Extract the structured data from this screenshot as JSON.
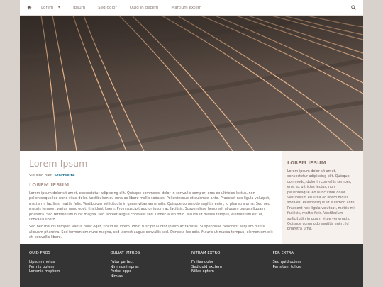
{
  "nav": {
    "items": [
      {
        "label": "Lorem",
        "has_dropdown": true
      },
      {
        "label": "Ipsum"
      },
      {
        "label": "Sed dolor"
      },
      {
        "label": "Quid in decem"
      },
      {
        "label": "Martium extem"
      }
    ]
  },
  "main": {
    "title": "Lorem Ipsum",
    "breadcrumb_prefix": "Sie sind hier:",
    "breadcrumb_link": "Startseite",
    "section_title": "LOREM IPSUM",
    "paragraphs": [
      "Lorem ipsum dolor sit amet, consectetur adipiscing elit. Quisque commodo, dolor in convallis semper, eros ex ultricies lectus, non pellentesque leo nunc vitae dolor. Vestibulum eu urna ac libero mollis sodales. Pellentesque ut euismod ante. Praesent nec ligula volutpat, mattis mi facilisis, mattis felis. Vestibulum sollicitudin in quam vitae venenatis. Quisque commodo sagittis enim, id pharetra urna. Sed nec mauris tempor, varius nunc eget, tincidunt lorem. Proin suscipit auctor ipsum ac facilisis. Suspendisse hendrerit aliquam purus aliquam pharetra. Sed fermentum nunc magna, sed laoreet augue convallis sed. Donec a leo odio. Mauris ut massa tempus, elementum elit et, convallis libero.",
      "Sed nec mauris tempor, varius nunc eget, tincidunt lorem. Proin suscipit auctor ipsum ac facilisis. Suspendisse hendrerit aliquam purus aliquam pharetra. Sed fermentum nunc magna, sed laoreet augue convallis sed. Donec a leo odio. Mauris ut massa tempus, elementum elit et, convallis libero."
    ]
  },
  "aside": {
    "title": "LOREM IPSUM",
    "text": "Lorem ipsum dolor sit amet, consectetur adipiscing elit. Quisque commodo, dolor in convallis semper, eros ex ultricies lectus, non pellentesque leo nunc vitae dolor. Vestibulum eu urna ac libero mollis sodales. Pellentesque ut euismod ante. Praesent nec ligula volutpat, mattis mi facilisis, mattis felis. Vestibulum sollicitudin in quam vitae venenatis. Quisque commodo sagittis enim, id pharetra urna."
  },
  "footer": {
    "columns": [
      {
        "heading": "QUID PROS",
        "links": [
          "Lipsum rhetus",
          "Permix optem",
          "Loremix moptem"
        ]
      },
      {
        "heading": "QULIAT IMPROS",
        "links": [
          "Futur perfect",
          "Nimmus impras",
          "Perlox oppo",
          "Nimias"
        ]
      },
      {
        "heading": "NITRAM EXTRO",
        "links": [
          "Finitas dolor",
          "Sed quid exctem",
          "Nillas optem"
        ]
      },
      {
        "heading": "PER EXTRA",
        "links": [
          "Sed quid octem",
          "Per sitem tulios"
        ]
      }
    ]
  },
  "colors": {
    "page_bg": "#d9d1cc",
    "footer_bg": "#343434",
    "link": "#257a96",
    "heading_muted": "#b6a49c",
    "aside_bg": "#f7f1ee"
  },
  "icons": [
    "home-icon",
    "search-icon"
  ],
  "hero": {
    "image": "railway-tracks-photo"
  }
}
